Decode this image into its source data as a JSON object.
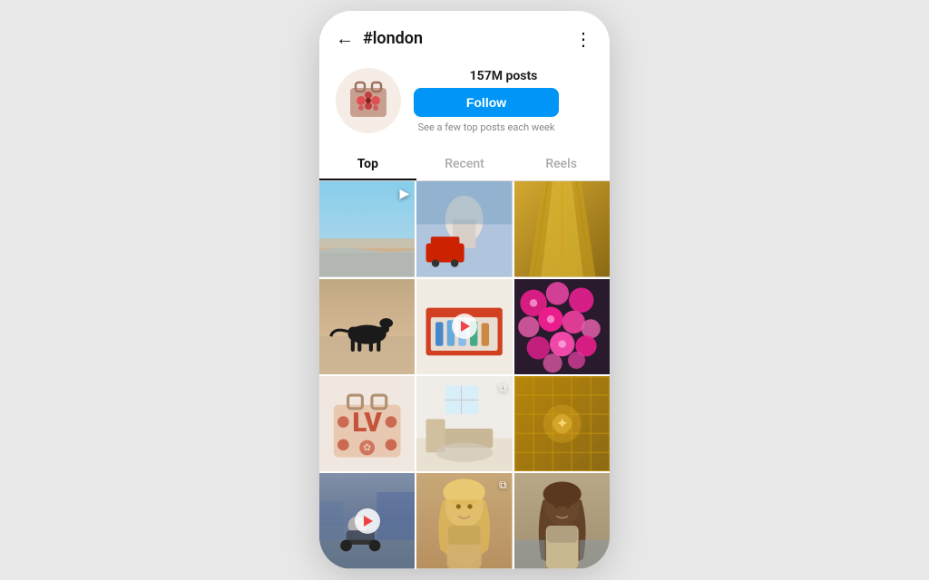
{
  "header": {
    "title": "#london",
    "back_label": "←",
    "more_label": "⋮"
  },
  "profile": {
    "posts_count": "157M",
    "posts_label": "posts",
    "follow_button": "Follow",
    "follow_hint": "See a few top posts each week"
  },
  "tabs": [
    {
      "label": "Top",
      "active": true
    },
    {
      "label": "Recent",
      "active": false
    },
    {
      "label": "Reels",
      "active": false
    }
  ],
  "grid": {
    "cells": [
      {
        "id": 1,
        "type": "reel",
        "color1": "#87ceeb",
        "color2": "#a0d8ef",
        "desc": "sky-beach-scene"
      },
      {
        "id": 2,
        "type": "normal",
        "color1": "#c0392b",
        "color2": "#2c3e50",
        "desc": "london-bus-cathedral"
      },
      {
        "id": 3,
        "type": "normal",
        "color1": "#c8a96e",
        "color2": "#8b6914",
        "desc": "golden-dress"
      },
      {
        "id": 4,
        "type": "normal",
        "color1": "#8b7355",
        "color2": "#c4a882",
        "desc": "horse-beach"
      },
      {
        "id": 5,
        "type": "video",
        "color1": "#cc0000",
        "color2": "#880000",
        "desc": "red-video"
      },
      {
        "id": 6,
        "type": "normal",
        "color1": "#e91e8c",
        "color2": "#ff69b4",
        "desc": "pink-flowers"
      },
      {
        "id": 7,
        "type": "normal",
        "color1": "#e8c8b0",
        "color2": "#d4a0a0",
        "desc": "patterned-bag"
      },
      {
        "id": 8,
        "type": "multi",
        "color1": "#f5f5f0",
        "color2": "#e0e0d8",
        "desc": "room-interior"
      },
      {
        "id": 9,
        "type": "normal",
        "color1": "#b8860b",
        "color2": "#daa520",
        "desc": "golden-tapestry"
      },
      {
        "id": 10,
        "type": "video",
        "color1": "#7090b0",
        "color2": "#4a6a8a",
        "desc": "person-motorbike"
      },
      {
        "id": 11,
        "type": "multi",
        "color1": "#d4a96e",
        "color2": "#c8965e",
        "desc": "woman-portrait"
      },
      {
        "id": 12,
        "type": "normal",
        "color1": "#a8956e",
        "color2": "#c0a878",
        "desc": "woman-portrait-2"
      }
    ]
  },
  "colors": {
    "follow_btn": "#0095f6",
    "tab_active": "#111111",
    "tab_inactive": "#aaaaaa"
  }
}
